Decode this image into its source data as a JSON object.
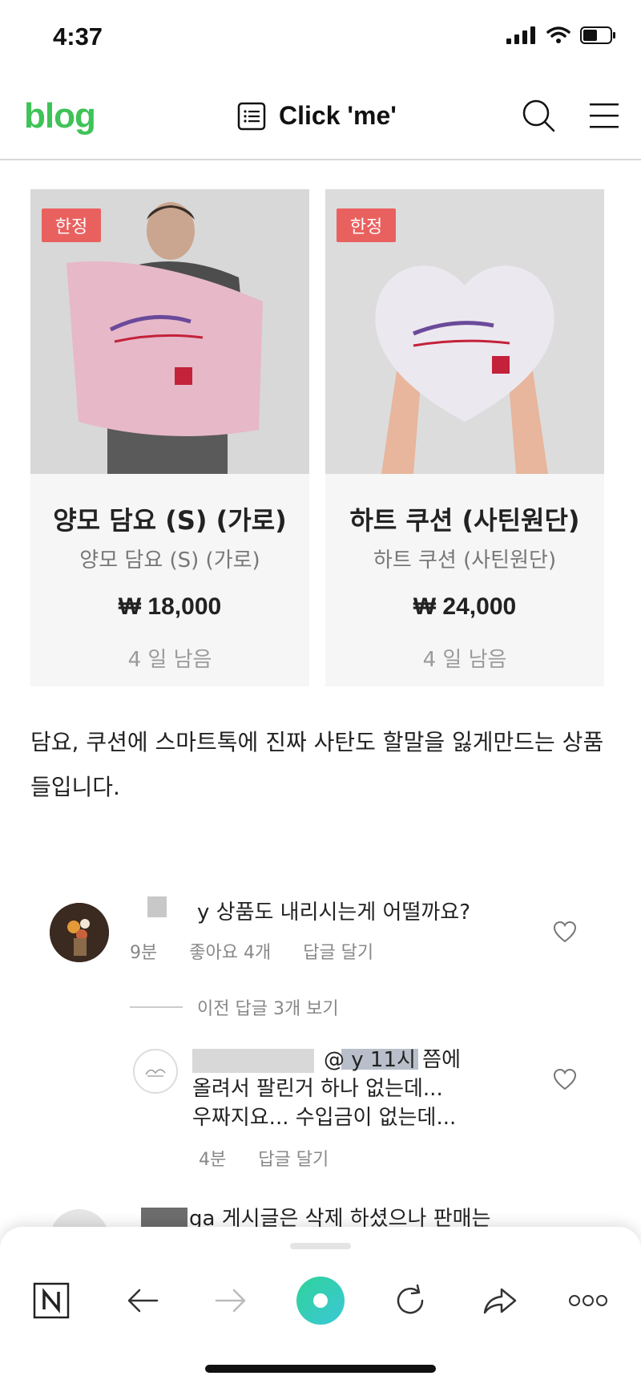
{
  "status_bar": {
    "time": "4:37"
  },
  "header": {
    "logo": "blog",
    "title": "Click 'me'"
  },
  "products": [
    {
      "badge": "한정",
      "name": "양모 담요 (S) (가로)",
      "subtitle": "양모 담요 (S) (가로)",
      "price": "₩ 18,000",
      "remaining": "4 일 남음"
    },
    {
      "badge": "한정",
      "name": "하트 쿠션 (사틴원단)",
      "subtitle": "하트 쿠션 (사틴원단)",
      "price": "₩ 24,000",
      "remaining": "4 일 남음"
    }
  ],
  "body_text": "담요, 쿠션에 스마트톡에 진짜 사탄도 할말을 잃게만드는 상품들입니다.",
  "comments": {
    "first": {
      "text": "y 상품도 내리시는게 어떨까요?",
      "time": "9분",
      "likes": "좋아요 4개",
      "reply": "답글 달기"
    },
    "view_previous": "이전 답글 3개 보기",
    "reply": {
      "text_line1": "@ y 11시 쯤에",
      "text_line2": "올려서 팔린거 하나 없는데...",
      "text_line3": "우짜지요... 수입금이 없는데...",
      "time": "4분",
      "reply": "답글 달기"
    },
    "third": {
      "text": "ga 게시글은 삭제 하셨으나 판매는"
    }
  },
  "toolbar": {
    "items": [
      "naver-home",
      "back",
      "forward",
      "green-dot",
      "reload",
      "share",
      "more"
    ]
  }
}
